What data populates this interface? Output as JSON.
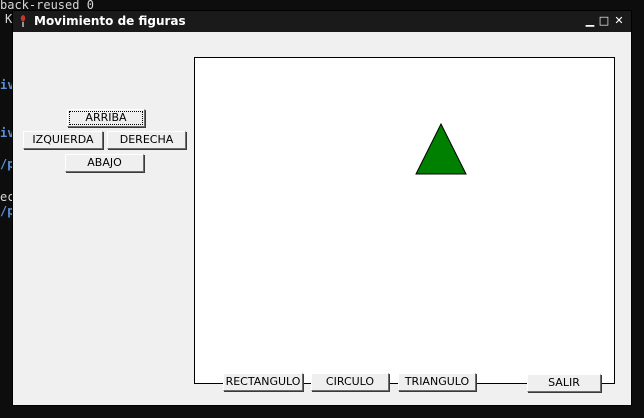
{
  "terminal": {
    "line1": "back-reused 0",
    "line2": "K",
    "frag_a": "iv",
    "frag_b": "iv",
    "frag_c": "/p",
    "frag_d": "ec",
    "frag_e": "/p"
  },
  "window": {
    "title": "Movimiento de figuras",
    "minimize": "▁",
    "maximize": "□",
    "close": "✕"
  },
  "controls": {
    "up": "ARRIBA",
    "left": "IZQUIERDA",
    "right": "DERECHA",
    "down": "ABAJO"
  },
  "shapes_bar": {
    "rectangle": "RECTANGULO",
    "circle": "CIRCULO",
    "triangle": "TRIANGULO",
    "exit": "SALIR"
  },
  "canvas": {
    "shape": "triangle",
    "shape_color": "#008000"
  }
}
